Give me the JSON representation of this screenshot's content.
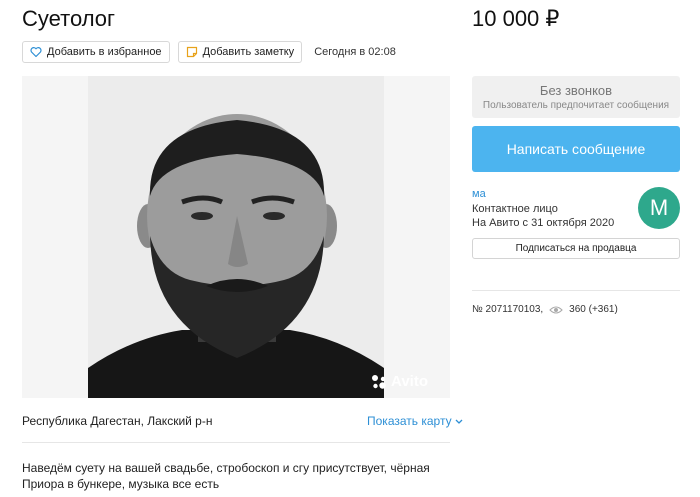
{
  "listing": {
    "title": "Суетолог",
    "price": "10 000 ₽",
    "posted": "Сегодня в 02:08"
  },
  "actions": {
    "favorite_label": "Добавить в избранное",
    "note_label": "Добавить заметку"
  },
  "photo": {
    "watermark": "Avito"
  },
  "location": {
    "address": "Республика Дагестан, Лакский р-н",
    "map_link": "Показать карту"
  },
  "description": "Наведём суету на вашей свадьбе, стробоскоп и сгу присутствует, чёрная Приора в бункере, музыка все есть",
  "contact": {
    "no_calls_title": "Без звонков",
    "no_calls_subtitle": "Пользователь предпочитает сообщения",
    "message_button": "Написать сообщение"
  },
  "seller": {
    "name": "ма",
    "role": "Контактное лицо",
    "since": "На Авито с 31 октября 2020",
    "avatar_letter": "M",
    "subscribe_label": "Подписаться на продавца"
  },
  "ad_info": {
    "number": "№ 2071170103,",
    "views": "360 (+361)"
  },
  "colors": {
    "accent": "#4cb4ef",
    "link": "#2d8fd5",
    "avatar": "#2ea88c"
  }
}
